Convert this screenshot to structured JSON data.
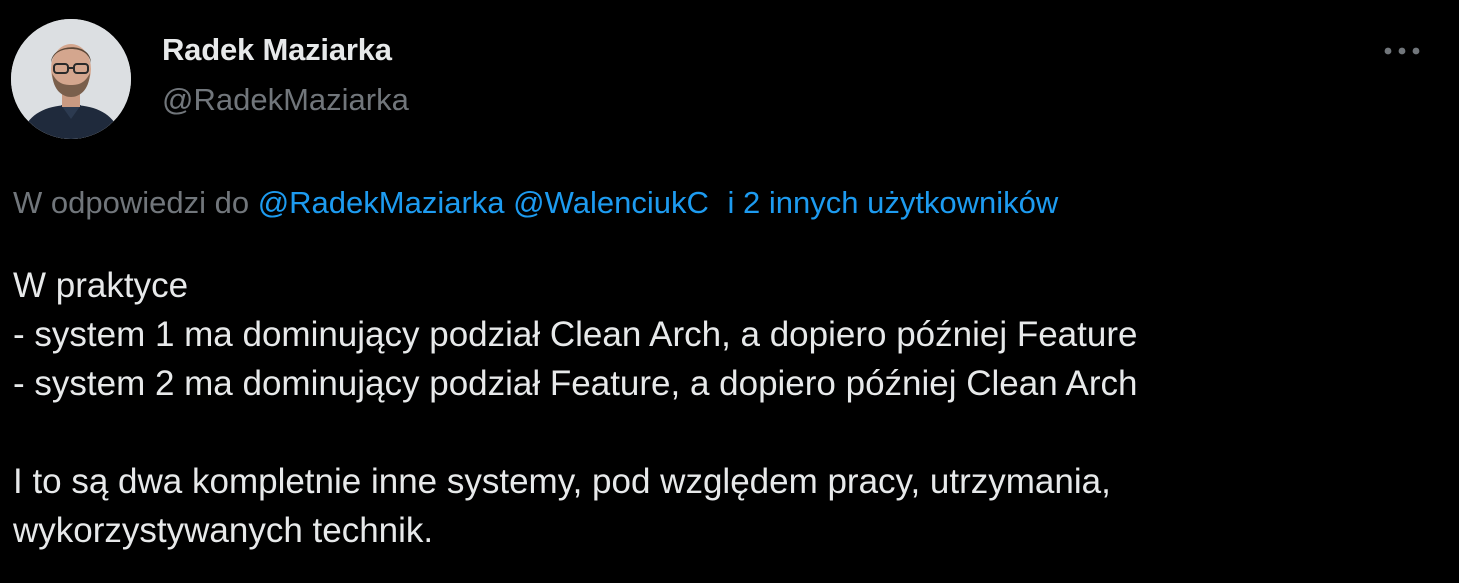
{
  "author": {
    "display_name": "Radek Maziarka",
    "handle": "@RadekMaziarka"
  },
  "icons": {
    "more": "more-horizontal-icon"
  },
  "reply_context": {
    "prefix": "W odpowiedzi do",
    "mentions": [
      "@RadekMaziarka",
      "@WalenciukC"
    ],
    "others": "i 2 innych użytkowników"
  },
  "tweet": {
    "lines": [
      "W praktyce",
      "- system 1 ma dominujący podział Clean Arch, a dopiero później Feature",
      "- system 2 ma dominujący podział Feature, a dopiero później Clean Arch",
      "",
      "I to są dwa kompletnie inne systemy, pod względem pracy, utrzymania,",
      "wykorzystywanych technik."
    ]
  },
  "colors": {
    "background": "#000000",
    "primary_text": "#e7e9ea",
    "secondary_text": "#71767b",
    "link": "#1d9bf0"
  }
}
